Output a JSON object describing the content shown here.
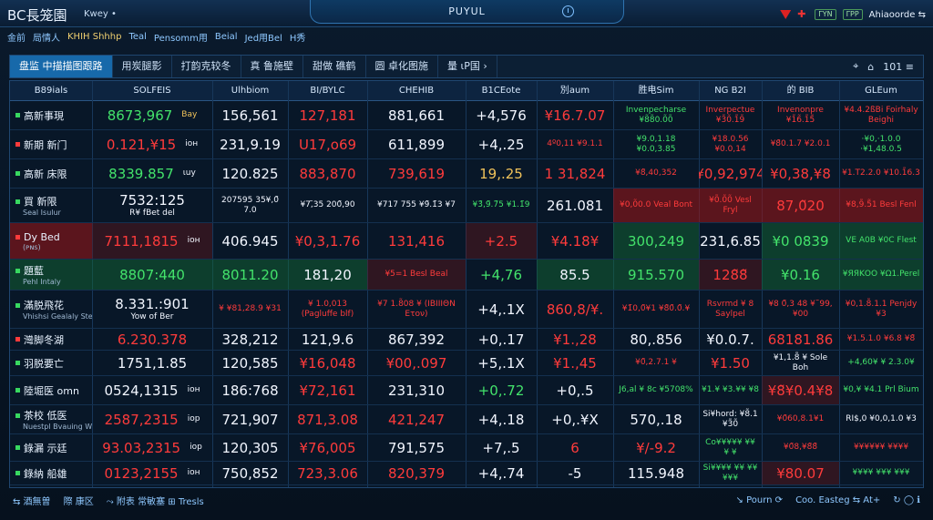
{
  "top": {
    "brand": "BC長笼園",
    "brand_sub": "Kwey •",
    "center_title": "PUYUL",
    "right_label": "Ahiaoorde ⇆",
    "btn1": "ΓΥΝ",
    "btn2": "ΓΡΡ"
  },
  "subbar": [
    "金前",
    "局情人 ",
    "ΚΗΙΗ Shhhp",
    "Teal",
    "Pensomm用",
    "Beial",
    "Jed用Bel",
    "H秀"
  ],
  "tabs": [
    "盘监 中描描图跟路",
    "用炭腿影",
    "打韵克较冬",
    "真 鲁施壁",
    "甜做 礁鹤",
    "圆 卓化图施",
    "量 ιΡ国 ›"
  ],
  "tab_tools": [
    "⌖",
    "⌂",
    "101 ≡"
  ],
  "columns": [
    "B89ials",
    "SOLFEIS",
    "Ulhbiom",
    "BI/BYLC",
    "CHEHIB",
    "B1CEote",
    "別aum",
    "胜电Sim",
    "NG B2I",
    "的 BIB",
    "GLEum"
  ],
  "rows": [
    {
      "n1": "高新事現",
      "n2": "",
      "dot": "g",
      "c1": "8673,967",
      "c1c": "g",
      "tag": "Bay",
      "tagc": "y",
      "c2": "156,561",
      "c2c": "w",
      "c3": "127,181",
      "c3c": "r",
      "c4": "881,661",
      "c4c": "w",
      "c5": "+4,576",
      "c5c": "w",
      "c6": "¥16.7.07",
      "c6c": "r",
      "c7": "Invenpecharse ¥8̃8̃0.0̃0̃",
      "c7c": "g",
      "c8": "Inverpectue ¥3̃0̃.1̃9̃",
      "c8c": "r",
      "c9": "Invenonpre ¥1̃6̃.1̃5̃",
      "c9c": "r",
      "c10": "¥4.4.2ßBi Foirhaly Beighi",
      "c10c": "r"
    },
    {
      "n1": "新期 新门",
      "n2": "",
      "dot": "r",
      "c1": "0.121,¥15",
      "c1c": "r",
      "tag": "iон",
      "tagc": "w",
      "c2": "231,9.19",
      "c2c": "w",
      "c3": "U17,o69",
      "c3c": "r",
      "c4": "611,899",
      "c4c": "w",
      "c5": "+4,.25",
      "c5c": "w",
      "c6": "4º0,11 ¥9.1.1",
      "c6c": "r",
      "c7": "¥9.0,1.18 ¥0.0,3.85",
      "c7c": "g",
      "c8": "¥18.0.56 ¥0.0,14",
      "c8c": "r",
      "c9": "¥8̃0.1.7 ¥2.0.1",
      "c9c": "r",
      "c10": "·¥0,·1.0.0 ·¥1,48.0.5",
      "c10c": "g"
    },
    {
      "n1": "高新 床限",
      "n2": "",
      "dot": "g",
      "c1": "8339.857",
      "c1c": "g",
      "tag": "ιuy",
      "tagc": "w",
      "c2": "120.825",
      "c2c": "w",
      "c3": "883,870",
      "c3c": "r",
      "c4": "739,619",
      "c4c": "r",
      "c5": "19,.25",
      "c5c": "y",
      "c6": "1 31,824",
      "c6c": "r",
      "c7": "¥8̃,40,352",
      "c7c": "r",
      "c8": "¥0,92,974",
      "c8c": "r",
      "c9": "¥0,38,¥8",
      "c9c": "r",
      "c10": "¥1.T2.2.0 ¥10.1̃6.3",
      "c10c": "r"
    },
    {
      "n1": "買 新限",
      "n2": "Seal Isulur",
      "dot": "g",
      "c1": "7532:125",
      "c1c": "w",
      "sub": "R¥ fBet del",
      "tag": "",
      "tagc": "w",
      "c2": "207595 35¥,0̃ 7.0",
      "c2c": "w",
      "c3": "¥7,̃35 200̃,90",
      "c3c": "w",
      "c4": "¥717 755 ¥9̃.1̃3 ¥7",
      "c4c": "w",
      "c5": "¥3̃,9̃.7̃5 ¥1.1̃9",
      "c5c": "g",
      "c6": "261.081",
      "c6c": "w",
      "c7": "¥0,0̃0.0 Veal Bont",
      "c7c": "r",
      "bg7": "r",
      "c8": "¥0̃.0̃0̃ Vesl Fryl",
      "c8c": "r",
      "bg8": "r",
      "c9": "87,0̃20",
      "c9c": "r",
      "bg9": "r",
      "c10": "¥8,9̃.5̃1 Besl Fenl",
      "c10c": "r",
      "bg10": "r"
    },
    {
      "n1": "Dy Bed",
      "n2": "(ᴘɴs)",
      "dot": "r",
      "bg0": "r",
      "c1": "7111,1815",
      "c1c": "r",
      "bg1": "rl",
      "tag": "iон",
      "tagc": "w",
      "c2": "406.945",
      "c2c": "w",
      "c3": "¥0,3,1.76",
      "c3c": "r",
      "c4": "131,416",
      "c4c": "r",
      "c5": "+2.5",
      "c5c": "r",
      "bg5": "rl",
      "c6": "¥4.18¥",
      "c6c": "r",
      "c7": "300,249",
      "c7c": "g",
      "bg7": "g",
      "c8": "231,6.85",
      "c8c": "w",
      "c9": "¥0 0839",
      "c9c": "g",
      "bg9": "g",
      "c10": "VE A0B ¥0C Flest",
      "c10c": "g",
      "bg10": "g"
    },
    {
      "n1": "題藍",
      "n2": "Pehl Intaly",
      "dot": "g",
      "bg0": "g",
      "c1": "8807:440",
      "c1c": "g",
      "bg1": "g",
      "tag": "",
      "tagc": "w",
      "c2": "8011.20",
      "c2c": "g",
      "bg2": "g",
      "c3": "181,20",
      "c3c": "w",
      "bg3": "g",
      "c4": "¥5=1 Besl Beal",
      "c4c": "r",
      "bg4": "rl",
      "c5": "+4,76",
      "c5c": "g",
      "c6": "85.5",
      "c6c": "w",
      "bg6": "g",
      "c7": "915.570",
      "c7c": "g",
      "bg7": "g",
      "c8": "128̃8̃",
      "c8c": "r",
      "bg8": "rl",
      "c9": "¥0.16",
      "c9c": "g",
      "bg9": "g",
      "c10": "¥ЯЯΚΟΟ ¥Ω1.Perel",
      "c10c": "g",
      "bg10": "g"
    },
    {
      "n1": "滿脱飛花",
      "n2": "Vhishsi Gealaly Stelantohnesa",
      "dot": "g",
      "c1": "8.331.:901",
      "c1c": "w",
      "sub": "Yow of Ber",
      "tag": "",
      "tagc": "w",
      "c2": "¥ ¥81,28.9 ¥31",
      "c2c": "r",
      "c3": "¥ 1.0,013 (Pagluffe blf)",
      "c3c": "r",
      "c4": "¥7 1.8̃08 ¥ (ΙΒΙΙΙΘΝ Ετον)",
      "c4c": "r",
      "c5": "+4,.1X",
      "c5c": "w",
      "c6": "860,8/¥.",
      "c6c": "r",
      "c7": "¥1̃0,0̃¥1 ¥8̃0̃.0̃.¥",
      "c7c": "r",
      "c8": "Rsvrmd ¥ 8 Saylpel",
      "c8c": "r",
      "c9": "¥8 0̃,3 48 ¥˜99,¥00",
      "c9c": "r",
      "c10": "¥0,1.8̃.1.1 Penjdy ¥3",
      "c10c": "r"
    },
    {
      "n1": "灣脚冬湖",
      "n2": "",
      "dot": "r",
      "c1": "6.230.378",
      "c1c": "r",
      "tag": "",
      "tagc": "w",
      "c2": "328,212",
      "c2c": "w",
      "c3": "121,9.6",
      "c3c": "w",
      "c4": "867,392",
      "c4c": "w",
      "c5": "+0,.17",
      "c5c": "w",
      "c6": "¥1.,28",
      "c6c": "r",
      "c7": "80,.856",
      "c7c": "w",
      "c8": "¥0.0.7.",
      "c8c": "w",
      "c9": "68181.86",
      "c9c": "r",
      "c10": "¥1.5.1.0 ¥6.8 ¥8̃",
      "c10c": "r"
    },
    {
      "n1": "羽脱要亡",
      "n2": "",
      "dot": "g",
      "c1": "1751,1.85",
      "c1c": "w",
      "tag": "",
      "tagc": "w",
      "c2": "120,585",
      "c2c": "w",
      "c3": "¥16,048",
      "c3c": "r",
      "c4": "¥00,.097",
      "c4c": "r",
      "c5": "+5,.1X",
      "c5c": "w",
      "c6": "¥1.,45",
      "c6c": "r",
      "c7": "¥0̃,2.7.1 ¥",
      "c7c": "r",
      "c8": "¥1.50",
      "c8c": "r",
      "c9": "¥1,1.8̃ ¥ Sole Boh",
      "c9c": "w",
      "c10": "+4,60¥ ¥ 2.3.0¥",
      "c10c": "g"
    },
    {
      "n1": "陸堀医 omn",
      "n2": "",
      "dot": "g",
      "c1": "0524,1315",
      "c1c": "w",
      "tag": "iон",
      "tagc": "w",
      "c2": "186:768",
      "c2c": "w",
      "c3": "¥72,161",
      "c3c": "r",
      "c4": "231,310",
      "c4c": "w",
      "c5": "+0,.72",
      "c5c": "g",
      "c6": "+0,.5",
      "c6c": "w",
      "c7": "J6,al ¥ 8c ¥5708%",
      "c7c": "g",
      "c8": "¥1.¥ ¥3.¥¥ ¥8",
      "c8c": "g",
      "c9": "¥8̃¥0.4¥8",
      "c9c": "r",
      "bg9": "rl",
      "c10": "¥0,¥ ¥4.1 Prl Bium",
      "c10c": "g"
    },
    {
      "n1": "茶校 低医",
      "n2": "Nuestpl Bvauing Wae",
      "dot": "g",
      "c1": "2587,2315",
      "c1c": "r",
      "tag": "iop",
      "tagc": "w",
      "c2": "721,907",
      "c2c": "w",
      "c3": "871,3.08",
      "c3c": "r",
      "c4": "421,247",
      "c4c": "r",
      "c5": "+4,.18",
      "c5c": "w",
      "c6": "+0,.¥X",
      "c6c": "w",
      "c7": "570,.18",
      "c7c": "w",
      "c8": "Si¥hord: ¥8̃.1 ¥3̃0̃",
      "c8c": "w",
      "c9": "¥0̃60,8.1¥1",
      "c9c": "r",
      "c10": "RI$,0 ¥0,0,1.0 ¥3",
      "c10c": "w"
    },
    {
      "n1": "錄漏 示廷",
      "n2": "",
      "dot": "g",
      "c1": "93.03,2315",
      "c1c": "r",
      "tag": "iop",
      "tagc": "w",
      "c2": "120,305",
      "c2c": "w",
      "c3": "¥76,005",
      "c3c": "r",
      "c4": "791,575",
      "c4c": "w",
      "c5": "+7,.5",
      "c5c": "w",
      "c6": "6",
      "c6c": "r",
      "c7": "¥/-9.2",
      "c7c": "r",
      "c8": "Co¥¥¥¥¥ ¥¥ ¥ ¥",
      "c8c": "g",
      "c9": "¥0̃8,¥8̃8̃",
      "c9c": "r",
      "c10": "¥¥¥¥¥¥ ¥¥¥¥",
      "c10c": "r"
    },
    {
      "n1": "錄納 船雄",
      "n2": "",
      "dot": "g",
      "c1": "0123,2155",
      "c1c": "r",
      "tag": "iон",
      "tagc": "w",
      "c2": "750,852",
      "c2c": "w",
      "c3": "723,3.06",
      "c3c": "r",
      "c4": "820,379",
      "c4c": "r",
      "c5": "+4,.74",
      "c5c": "w",
      "c6": "-5",
      "c6c": "w",
      "c7": "115.948",
      "c7c": "w",
      "c8": "Si¥¥¥¥ ¥¥ ¥¥¥¥¥",
      "c8c": "g",
      "c9": "¥80.07",
      "c9c": "r",
      "bg9": "rl",
      "c10": "¥¥¥¥ ¥¥¥ ¥¥¥",
      "c10c": "g"
    }
  ],
  "footer": {
    "left": [
      "⇆ 酒無曽",
      "際 康区",
      "⤳ 附表 常敏塞 ⊞ Tresls"
    ],
    "right": [
      "↘ Pourn ⟳",
      "Coo. Easteg ⇆ At+",
      "↻ ◯ ℹ"
    ]
  }
}
